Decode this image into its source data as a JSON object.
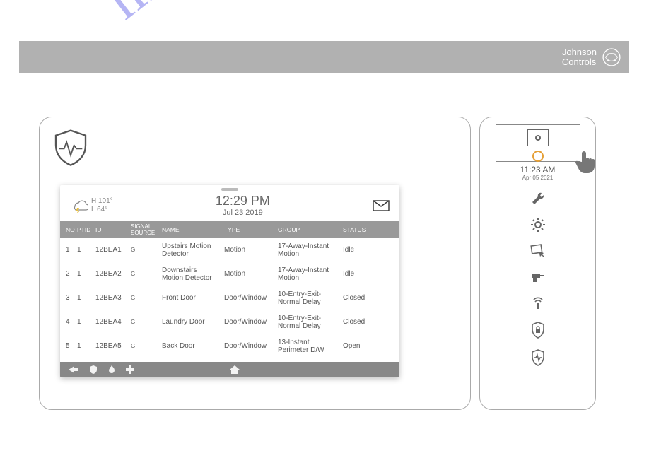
{
  "brand": {
    "line1": "Johnson",
    "line2": "Controls"
  },
  "watermark": "manualshive.com",
  "card": {
    "weather": {
      "high": "H 101°",
      "low": "L 64°"
    },
    "clock": {
      "time": "12:29 PM",
      "date": "Jul 23 2019"
    },
    "columns": {
      "no": "NO",
      "ptid": "PTID",
      "id": "ID",
      "sig": "SIGNAL SOURCE",
      "name": "NAME",
      "type": "TYPE",
      "group": "GROUP",
      "status": "STATUS"
    },
    "rows": [
      {
        "no": "1",
        "ptid": "1",
        "id": "12BEA1",
        "sig": "G",
        "name": "Upstairs Motion Detector",
        "type": "Motion",
        "group": "17-Away-Instant Motion",
        "status": "Idle"
      },
      {
        "no": "2",
        "ptid": "1",
        "id": "12BEA2",
        "sig": "G",
        "name": "Downstairs Motion Detector",
        "type": "Motion",
        "group": "17-Away-Instant Motion",
        "status": "Idle"
      },
      {
        "no": "3",
        "ptid": "1",
        "id": "12BEA3",
        "sig": "G",
        "name": "Front Door",
        "type": "Door/Window",
        "group": "10-Entry-Exit-Normal Delay",
        "status": "Closed"
      },
      {
        "no": "4",
        "ptid": "1",
        "id": "12BEA4",
        "sig": "G",
        "name": "Laundry Door",
        "type": "Door/Window",
        "group": "10-Entry-Exit-Normal Delay",
        "status": "Closed"
      },
      {
        "no": "5",
        "ptid": "1",
        "id": "12BEA5",
        "sig": "G",
        "name": "Back Door",
        "type": "Door/Window",
        "group": "13-Instant Perimeter D/W",
        "status": "Open"
      }
    ]
  },
  "side": {
    "time": "11:23 AM",
    "date": "Apr 05 2021"
  }
}
